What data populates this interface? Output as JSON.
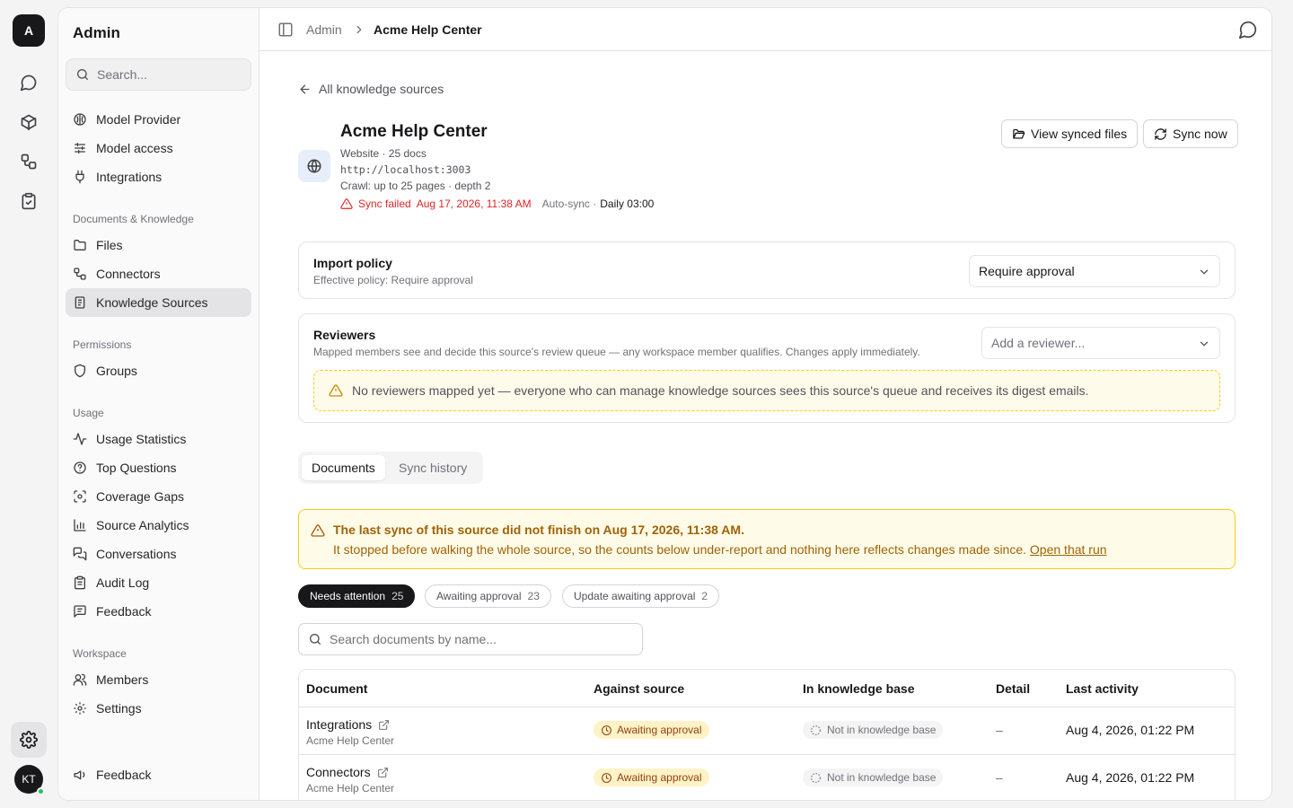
{
  "rail": {
    "logo": "A",
    "avatar": "KT",
    "icons": [
      "chat-icon",
      "cube-icon",
      "workflow-icon",
      "clipboard-check-icon",
      "settings-icon"
    ]
  },
  "sidebar": {
    "title": "Admin",
    "search_placeholder": "Search...",
    "items_top": [
      {
        "label": "Model Provider",
        "icon": "brain-icon"
      },
      {
        "label": "Model access",
        "icon": "sliders-icon"
      },
      {
        "label": "Integrations",
        "icon": "plug-icon"
      }
    ],
    "section_docs": "Documents & Knowledge",
    "items_docs": [
      {
        "label": "Files",
        "icon": "folder-icon"
      },
      {
        "label": "Connectors",
        "icon": "connector-icon"
      },
      {
        "label": "Knowledge Sources",
        "icon": "book-icon",
        "active": true
      }
    ],
    "section_permissions": "Permissions",
    "items_permissions": [
      {
        "label": "Groups",
        "icon": "shield-icon"
      }
    ],
    "section_usage": "Usage",
    "items_usage": [
      {
        "label": "Usage Statistics",
        "icon": "activity-icon"
      },
      {
        "label": "Top Questions",
        "icon": "help-circle-icon"
      },
      {
        "label": "Coverage Gaps",
        "icon": "scan-icon"
      },
      {
        "label": "Source Analytics",
        "icon": "bar-chart-icon"
      },
      {
        "label": "Conversations",
        "icon": "messages-icon"
      },
      {
        "label": "Audit Log",
        "icon": "clipboard-list-icon"
      },
      {
        "label": "Feedback",
        "icon": "message-square-icon"
      }
    ],
    "section_workspace": "Workspace",
    "items_workspace": [
      {
        "label": "Members",
        "icon": "users-icon"
      },
      {
        "label": "Settings",
        "icon": "gear-icon"
      }
    ],
    "bottom_item": {
      "label": "Feedback",
      "icon": "megaphone-icon"
    }
  },
  "topbar": {
    "crumb_parent": "Admin",
    "crumb_current": "Acme Help Center"
  },
  "source": {
    "back_label": "All knowledge sources",
    "title": "Acme Help Center",
    "meta": "Website · 25 docs",
    "url": "http://localhost:3003",
    "crawl": "Crawl: up to 25 pages · depth 2",
    "sync_status": "Sync failed",
    "sync_time": "Aug 17, 2026, 11:38 AM",
    "auto_sync_label": "Auto-sync ·",
    "auto_sync_value": "Daily 03:00",
    "view_files_label": "View synced files",
    "sync_now_label": "Sync now"
  },
  "import_policy": {
    "title": "Import policy",
    "subtitle": "Effective policy: Require approval",
    "selected": "Require approval"
  },
  "reviewers": {
    "title": "Reviewers",
    "subtitle": "Mapped members see and decide this source's review queue — any workspace member qualifies. Changes apply immediately.",
    "placeholder": "Add a reviewer...",
    "warning": "No reviewers mapped yet — everyone who can manage knowledge sources sees this source's queue and receives its digest emails."
  },
  "tabs": [
    {
      "label": "Documents",
      "active": true
    },
    {
      "label": "Sync history",
      "active": false
    }
  ],
  "alert": {
    "line1": "The last sync of this source did not finish on Aug 17, 2026, 11:38 AM.",
    "line2": "It stopped before walking the whole source, so the counts below under-report and nothing here reflects changes made since.",
    "link": "Open that run"
  },
  "filters": [
    {
      "label": "Needs attention",
      "count": "25",
      "active": true
    },
    {
      "label": "Awaiting approval",
      "count": "23",
      "active": false
    },
    {
      "label": "Update awaiting approval",
      "count": "2",
      "active": false
    }
  ],
  "doc_search_placeholder": "Search documents by name...",
  "table": {
    "headers": [
      "Document",
      "Against source",
      "In knowledge base",
      "Detail",
      "Last activity"
    ],
    "rows": [
      {
        "name": "Integrations",
        "source": "Acme Help Center",
        "against": "Awaiting approval",
        "kb": "Not in knowledge base",
        "detail": "–",
        "last": "Aug 4, 2026, 01:22 PM"
      },
      {
        "name": "Connectors",
        "source": "Acme Help Center",
        "against": "Awaiting approval",
        "kb": "Not in knowledge base",
        "detail": "–",
        "last": "Aug 4, 2026, 01:22 PM"
      }
    ]
  },
  "colors": {
    "accent_dark": "#18181b",
    "error": "#dc2626",
    "warning_bg": "#fefce8",
    "warning_text": "#a16207",
    "badge_amber_bg": "#fef3c7"
  }
}
